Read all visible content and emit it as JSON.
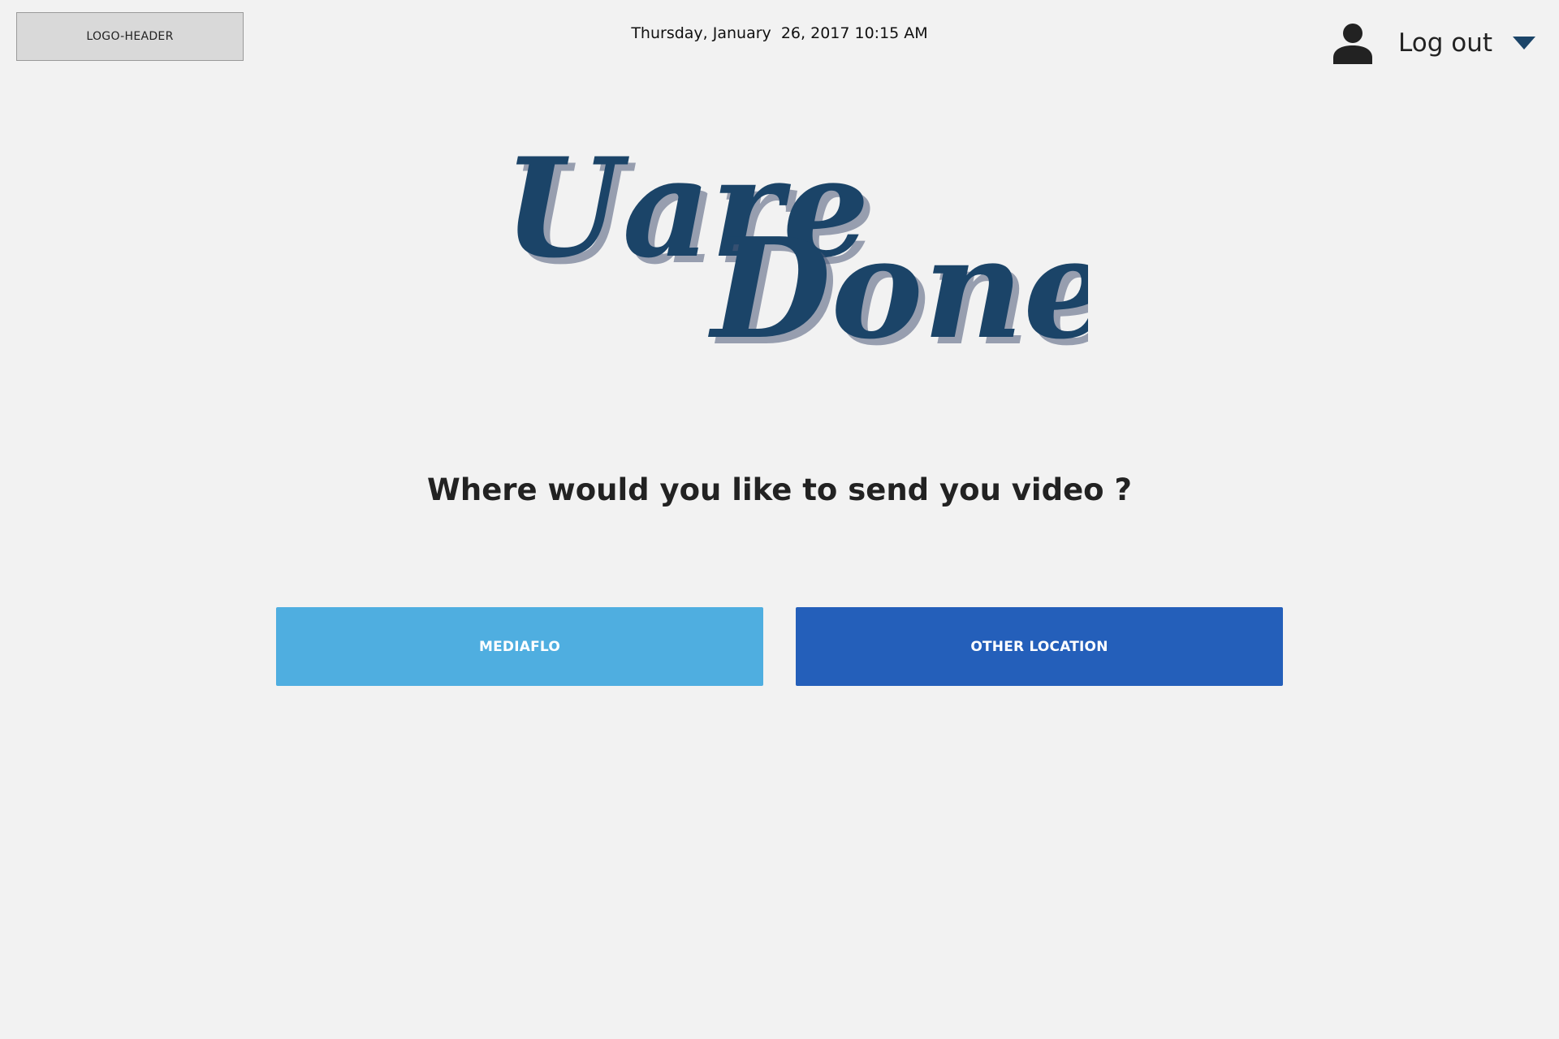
{
  "header": {
    "logo_label": "LOGO-HEADER",
    "datetime": "Thursday, January  26, 2017 10:15 AM",
    "user_menu": {
      "label": "Log out",
      "icon": "user-icon",
      "caret_icon": "caret-down-icon"
    }
  },
  "hero": {
    "title_line1": "Uare",
    "title_line2": "Done",
    "color": "#1b4468"
  },
  "main": {
    "question": "Where would you like to send you video ?",
    "buttons": [
      {
        "label": "MEDIAFLO",
        "color": "#4faee0"
      },
      {
        "label": "OTHER LOCATION",
        "color": "#245fba"
      }
    ]
  }
}
